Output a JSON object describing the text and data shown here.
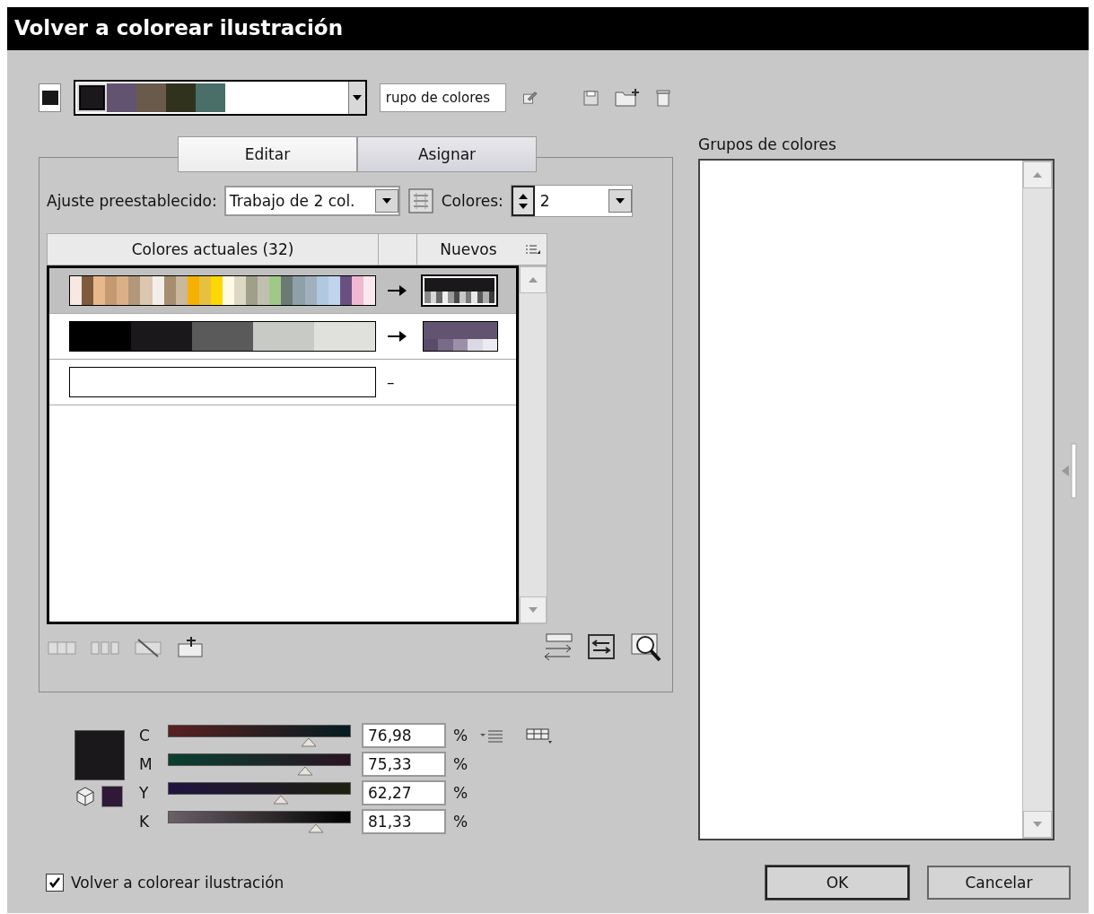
{
  "window": {
    "title": "Volver a colorear ilustración"
  },
  "top_bar": {
    "current_swatch": {
      "color": "#1a181a"
    },
    "swatches": [
      {
        "color": "#1a181a",
        "selected": true
      },
      {
        "color": "#625470",
        "selected": false
      },
      {
        "color": "#6a5a4c",
        "selected": false
      },
      {
        "color": "#30321e",
        "selected": false
      },
      {
        "color": "#4a6e68",
        "selected": false
      }
    ],
    "group_name": "rupo de colores"
  },
  "tabs": [
    {
      "label": "Editar",
      "selected": true
    },
    {
      "label": "Asignar",
      "selected": false
    }
  ],
  "preset": {
    "label": "Ajuste preestablecido:",
    "value": "Trabajo de 2 col.",
    "colors_label": "Colores:",
    "colors_value": "2"
  },
  "table": {
    "columns": [
      "Colores actuales (32)",
      "Nuevos"
    ],
    "rows": [
      {
        "selected": true,
        "kind": "mapped",
        "current": [
          {
            "color": "#f8e8e4"
          },
          {
            "color": "#7f5a3c"
          },
          {
            "color": "#e8b88c"
          },
          {
            "color": "#c59a70"
          },
          {
            "color": "#d9b088"
          },
          {
            "color": "#b3977a"
          },
          {
            "color": "#dcc6b0"
          },
          {
            "color": "#f3efe8"
          },
          {
            "color": "#a78e70"
          },
          {
            "color": "#c9b89c"
          },
          {
            "color": "#f5b000"
          },
          {
            "color": "#e8c040"
          },
          {
            "color": "#ffd800"
          },
          {
            "color": "#fefbe2"
          },
          {
            "color": "#dcd8c4"
          },
          {
            "color": "#a0a088"
          },
          {
            "color": "#c0c0b0"
          },
          {
            "color": "#a0c888"
          },
          {
            "color": "#6c7a74"
          },
          {
            "color": "#8fa0a8"
          },
          {
            "color": "#a0b0bc"
          },
          {
            "color": "#b0c8e0"
          },
          {
            "color": "#c0d4ec"
          },
          {
            "color": "#6a5080"
          },
          {
            "color": "#f0b8d0"
          },
          {
            "color": "#fbe8ef"
          }
        ],
        "new": {
          "color": "#1a181a"
        },
        "new_shades": [
          {
            "color": "#8a8a8a"
          },
          {
            "color": "#d8d8d8"
          },
          {
            "color": "#6a6a6a"
          },
          {
            "color": "#f0f0f0"
          },
          {
            "color": "#9a9a9a"
          },
          {
            "color": "#4a4a4a"
          },
          {
            "color": "#c8c8c8"
          },
          {
            "color": "#7a7a7a"
          },
          {
            "color": "#e8e8e8"
          },
          {
            "color": "#5a5a5a"
          },
          {
            "color": "#b0b0b0"
          },
          {
            "color": "#3a3a3a"
          }
        ]
      },
      {
        "selected": false,
        "kind": "mapped",
        "current": [
          {
            "color": "#000000"
          },
          {
            "color": "#1a181a"
          },
          {
            "color": "#5a5a5a"
          },
          {
            "color": "#c8cac6"
          },
          {
            "color": "#e0e0dc"
          }
        ],
        "new": {
          "color": "#625470"
        },
        "new_shades": [
          {
            "color": "#5a4c68"
          },
          {
            "color": "#786a88"
          },
          {
            "color": "#9c90a8"
          },
          {
            "color": "#dcd8e4"
          },
          {
            "color": "#ececf0"
          }
        ]
      },
      {
        "selected": false,
        "kind": "empty",
        "current": [],
        "dash": "–"
      }
    ]
  },
  "sliders": {
    "swatch": {
      "color": "#1a181a"
    },
    "out_of_gamut": {
      "color": "#301838"
    },
    "channels": [
      {
        "name": "C",
        "level": 0.77,
        "value": "76,98",
        "unit": "%"
      },
      {
        "name": "M",
        "level": 0.75,
        "value": "75,33",
        "unit": "%"
      },
      {
        "name": "Y",
        "level": 0.62,
        "value": "62,27",
        "unit": "%"
      },
      {
        "name": "K",
        "level": 0.81,
        "value": "81,33",
        "unit": "%"
      }
    ]
  },
  "recolor": {
    "label": "Volver a colorear ilustración",
    "checked": true
  },
  "groups": {
    "label": "Grupos de colores"
  },
  "buttons": [
    "OK",
    "Cancelar"
  ]
}
